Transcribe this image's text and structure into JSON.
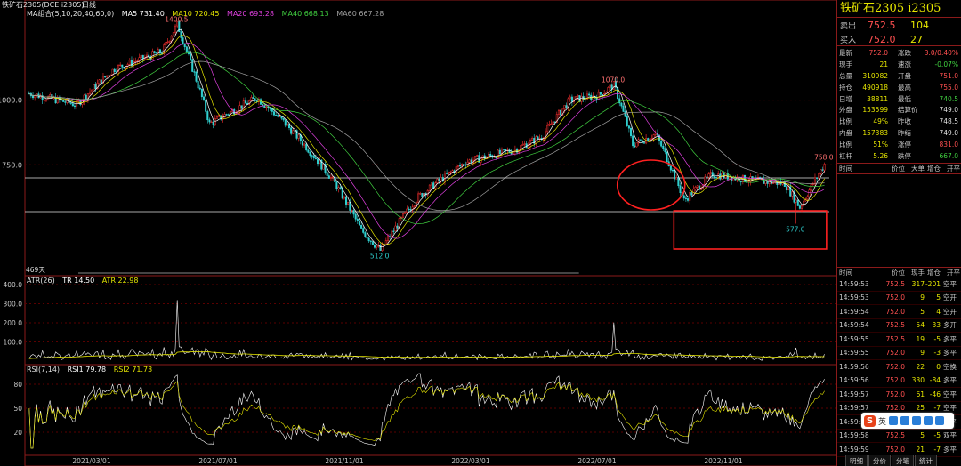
{
  "header": {
    "title": "铁矿石2305(DCE i2305)",
    "period": "日线"
  },
  "main_legend": {
    "group": "MA组合(5,10,20,40,60,0)",
    "ma5": "MA5 731.40",
    "ma10": "MA10 720.45",
    "ma20": "MA20 693.28",
    "ma40": "MA40 668.13",
    "ma60": "MA60 667.28"
  },
  "colors": {
    "ma5": "#ffffff",
    "ma10": "#e6e600",
    "ma20": "#e040e0",
    "ma40": "#40d040",
    "ma60": "#a0a0a0",
    "up": "#ff3030",
    "down": "#30d0d0",
    "border": "#8b1a1a",
    "annotation": "#ff2020"
  },
  "price_axis": {
    "labels": [
      "1000.0",
      "750.0"
    ]
  },
  "price_annotations": {
    "high1": "1400.5",
    "high2": "1070.0",
    "high3": "758.0",
    "low1": "512.0",
    "low2": "577.0",
    "days": "469天"
  },
  "atr_panel": {
    "legend": "ATR(26)",
    "tr": "TR 14.50",
    "atr": "ATR 22.98",
    "axis": [
      "400.0",
      "300.0",
      "200.0",
      "100.0"
    ]
  },
  "rsi_panel": {
    "legend": "RSI(7,14)",
    "rsi1": "RSI1 79.78",
    "rsi2": "RSI2 71.73",
    "axis": [
      "80",
      "50",
      "20"
    ]
  },
  "date_axis": [
    "2021/03/01",
    "2021/07/01",
    "2021/11/01",
    "2022/03/01",
    "2022/07/01",
    "2022/11/01"
  ],
  "chart_data": {
    "type": "candlestick",
    "title": "铁矿石2305(DCE i2305)",
    "ylim": [
      480,
      1420
    ],
    "highs_marked": [
      1400.5,
      1070.0,
      758.0
    ],
    "lows_marked": [
      512.0,
      577.0
    ],
    "ma_values": {
      "MA5": 731.4,
      "MA10": 720.45,
      "MA20": 693.28,
      "MA40": 668.13,
      "MA60": 667.28
    },
    "atr": {
      "TR": 14.5,
      "ATR": 22.98,
      "ylim": [
        0,
        400
      ]
    },
    "rsi": {
      "RSI1": 79.78,
      "RSI2": 71.73,
      "levels": [
        20,
        50,
        80
      ]
    },
    "x_ticks": [
      "2021/03/01",
      "2021/07/01",
      "2021/11/01",
      "2022/03/01",
      "2022/07/01",
      "2022/11/01"
    ]
  },
  "side": {
    "title": "铁矿石2305  i2305",
    "ask_label": "卖出",
    "ask_price": "752.5",
    "ask_vol": "104",
    "bid_label": "买入",
    "bid_price": "752.0",
    "bid_vol": "27",
    "quote_rows": [
      {
        "k1": "最新",
        "v1": "752.0",
        "c1": "#ff5050",
        "k2": "涨跌",
        "v2": "3.0/0.40%",
        "c2": "#ff5050"
      },
      {
        "k1": "现手",
        "v1": "21",
        "c1": "#e6e600",
        "k2": "速涨",
        "v2": "-0.07%",
        "c2": "#40d040"
      },
      {
        "k1": "总量",
        "v1": "310982",
        "c1": "#e6e600",
        "k2": "开盘",
        "v2": "751.0",
        "c2": "#ff5050"
      },
      {
        "k1": "持仓",
        "v1": "490918",
        "c1": "#e6e600",
        "k2": "最高",
        "v2": "755.0",
        "c2": "#ff5050"
      },
      {
        "k1": "日增",
        "v1": "38811",
        "c1": "#e6e600",
        "k2": "最低",
        "v2": "740.5",
        "c2": "#40d040"
      },
      {
        "k1": "外盘",
        "v1": "153599",
        "c1": "#e6e600",
        "k2": "结算价",
        "v2": "749.0",
        "c2": "#e0e0e0"
      },
      {
        "k1": "比例",
        "v1": "49%",
        "c1": "#e6e600",
        "k2": "昨收",
        "v2": "748.5",
        "c2": "#e0e0e0"
      },
      {
        "k1": "内盘",
        "v1": "157383",
        "c1": "#e6e600",
        "k2": "昨结",
        "v2": "749.0",
        "c2": "#e0e0e0"
      },
      {
        "k1": "比例",
        "v1": "51%",
        "c1": "#e6e600",
        "k2": "涨停",
        "v2": "831.0",
        "c2": "#ff5050"
      },
      {
        "k1": "杠杆",
        "v1": "5.26",
        "c1": "#e6e600",
        "k2": "跌停",
        "v2": "667.0",
        "c2": "#40d040"
      }
    ],
    "header1": [
      "时间",
      "价位",
      "大单",
      "增仓",
      "开平"
    ],
    "header2": [
      "时间",
      "价位",
      "现手",
      "增仓",
      "开平"
    ],
    "ticks": [
      {
        "t": "14:59:53",
        "p": "752.5",
        "v": "317",
        "c": "-201",
        "cc": "#e6e600",
        "tt": "空平"
      },
      {
        "t": "14:59:53",
        "p": "752.0",
        "v": "9",
        "c": "5",
        "cc": "#e6e600",
        "tt": "空开"
      },
      {
        "t": "14:59:54",
        "p": "752.0",
        "v": "5",
        "c": "4",
        "cc": "#e6e600",
        "tt": "空开"
      },
      {
        "t": "14:59:54",
        "p": "752.5",
        "v": "54",
        "c": "33",
        "cc": "#e6e600",
        "tt": "多开"
      },
      {
        "t": "14:59:55",
        "p": "752.5",
        "v": "19",
        "c": "-5",
        "cc": "#e6e600",
        "tt": "多平"
      },
      {
        "t": "14:59:55",
        "p": "752.0",
        "v": "9",
        "c": "-3",
        "cc": "#e6e600",
        "tt": "多平"
      },
      {
        "t": "14:59:56",
        "p": "752.0",
        "v": "22",
        "c": "0",
        "cc": "#e6e600",
        "tt": "空换"
      },
      {
        "t": "14:59:56",
        "p": "752.0",
        "v": "330",
        "c": "-84",
        "cc": "#e6e600",
        "tt": "多平"
      },
      {
        "t": "14:59:57",
        "p": "752.0",
        "v": "61",
        "c": "-46",
        "cc": "#e6e600",
        "tt": "空平"
      },
      {
        "t": "14:59:57",
        "p": "752.0",
        "v": "25",
        "c": "-7",
        "cc": "#e6e600",
        "tt": "空平"
      },
      {
        "t": "14:59:58",
        "p": "752.0",
        "v": "94",
        "c": "-56",
        "cc": "#e6e600",
        "tt": "空平"
      },
      {
        "t": "14:59:58",
        "p": "752.5",
        "v": "5",
        "c": "-5",
        "cc": "#e6e600",
        "tt": "双平"
      },
      {
        "t": "14:59:59",
        "p": "752.0",
        "v": "21",
        "c": "-7",
        "cc": "#e6e600",
        "tt": "多平"
      }
    ],
    "tabs": [
      "明细",
      "分价",
      "分笔",
      "统计"
    ]
  },
  "ime": {
    "label": "英"
  }
}
